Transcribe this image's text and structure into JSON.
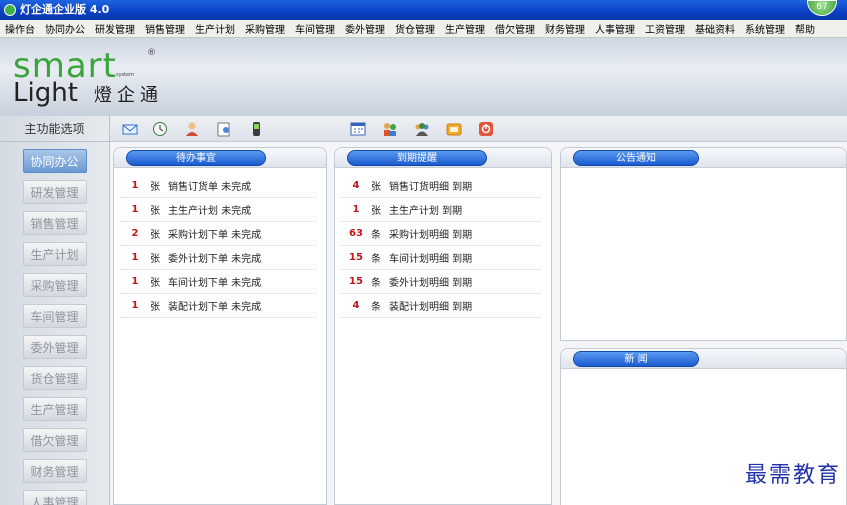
{
  "window": {
    "title": "灯企通企业版 4.0",
    "badge": "67"
  },
  "menu": [
    "操作台",
    "协同办公",
    "研发管理",
    "销售管理",
    "生产计划",
    "采购管理",
    "车间管理",
    "委外管理",
    "货仓管理",
    "生产管理",
    "借欠管理",
    "财务管理",
    "人事管理",
    "工资管理",
    "基础资料",
    "系统管理",
    "帮助"
  ],
  "logo": {
    "smart": "smart",
    "light": "Light",
    "cn": "燈企通",
    "reg": "®",
    "system": "system"
  },
  "sidebar": {
    "title": "主功能选项",
    "items": [
      "协同办公",
      "研发管理",
      "销售管理",
      "生产计划",
      "采购管理",
      "车间管理",
      "委外管理",
      "货仓管理",
      "生产管理",
      "借欠管理",
      "财务管理",
      "人事管理"
    ]
  },
  "panels": {
    "todo": {
      "title": "待办事宜",
      "rows": [
        {
          "count": "1",
          "unit": "张",
          "text": "销售订货单 未完成"
        },
        {
          "count": "1",
          "unit": "张",
          "text": "主生产计划 未完成"
        },
        {
          "count": "2",
          "unit": "张",
          "text": "采购计划下单 未完成"
        },
        {
          "count": "1",
          "unit": "张",
          "text": "委外计划下单 未完成"
        },
        {
          "count": "1",
          "unit": "张",
          "text": "车间计划下单 未完成"
        },
        {
          "count": "1",
          "unit": "张",
          "text": "装配计划下单 未完成"
        }
      ]
    },
    "due": {
      "title": "到期提醒",
      "rows": [
        {
          "count": "4",
          "unit": "张",
          "text": "销售订货明细 到期"
        },
        {
          "count": "1",
          "unit": "张",
          "text": "主生产计划 到期"
        },
        {
          "count": "63",
          "unit": "条",
          "text": "采购计划明细 到期"
        },
        {
          "count": "15",
          "unit": "条",
          "text": "车间计划明细 到期"
        },
        {
          "count": "15",
          "unit": "条",
          "text": "委外计划明细 到期"
        },
        {
          "count": "4",
          "unit": "条",
          "text": "装配计划明细 到期"
        }
      ]
    },
    "notice": {
      "title": "公告通知"
    },
    "news": {
      "title": "新 闻"
    }
  },
  "watermark": "最需教育",
  "colors": {
    "accent": "#1a5bd0",
    "count": "#c0161b",
    "logo_green": "#3aa43d"
  },
  "toolbar_icons": [
    "mail-icon",
    "clock-icon",
    "user-icon",
    "document-person-icon",
    "phone-icon",
    "calendar-icon",
    "people-icon",
    "users-group-icon",
    "folder-icon",
    "power-icon"
  ]
}
